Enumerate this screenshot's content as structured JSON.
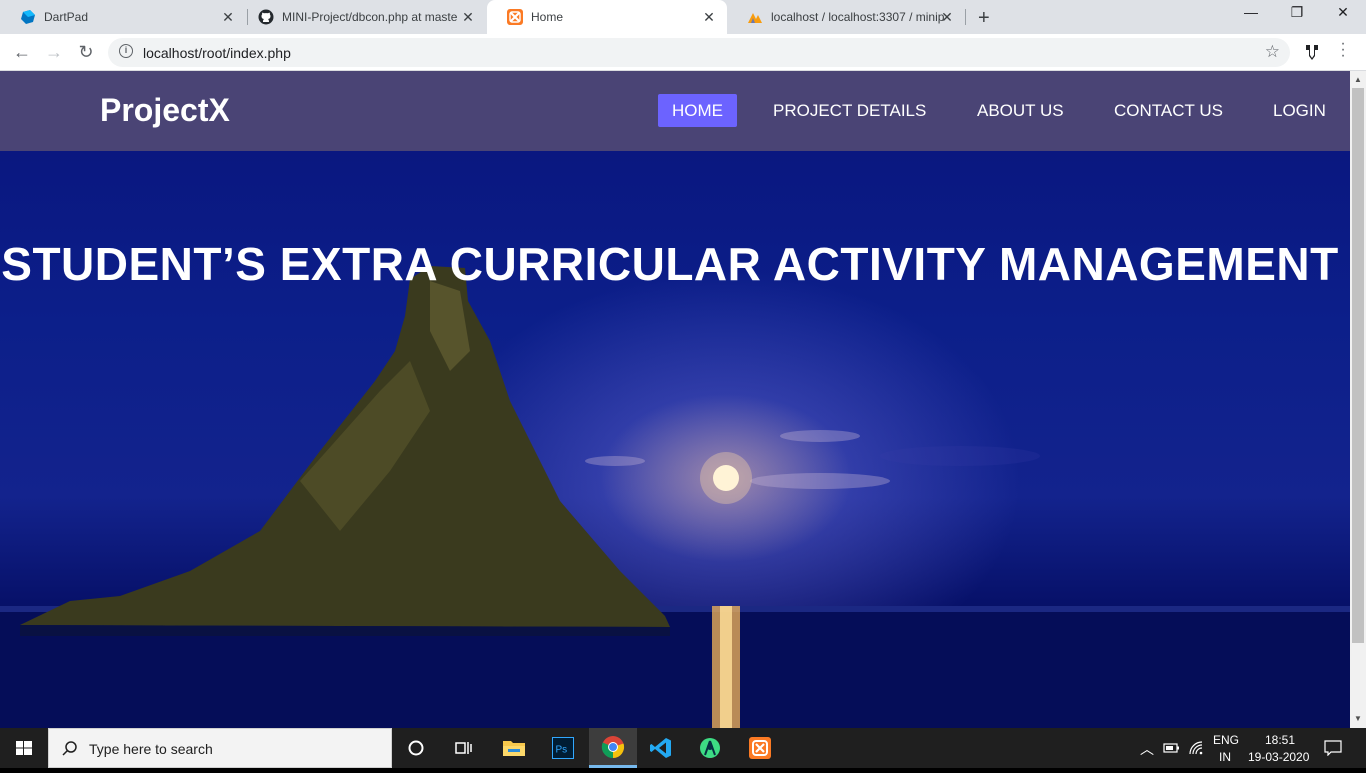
{
  "browser": {
    "tabs": [
      {
        "title": "DartPad",
        "icon": "dartpad-icon",
        "active": false
      },
      {
        "title": "MINI-Project/dbcon.php at maste",
        "icon": "github-icon",
        "active": false
      },
      {
        "title": "Home",
        "icon": "xampp-icon",
        "active": true
      },
      {
        "title": "localhost / localhost:3307 / minip",
        "icon": "phpmyadmin-icon",
        "active": false
      }
    ],
    "new_tab": "+",
    "url": "localhost/root/index.php"
  },
  "site": {
    "brand": "ProjectX",
    "nav": [
      {
        "label": "HOME",
        "active": true
      },
      {
        "label": "PROJECT DETAILS",
        "active": false
      },
      {
        "label": "ABOUT US",
        "active": false
      },
      {
        "label": "CONTACT US",
        "active": false
      },
      {
        "label": "LOGIN",
        "active": false
      }
    ],
    "hero_title": "STUDENT’S EXTRA  CURRICULAR ACTIVITY MANAGEMENT"
  },
  "taskbar": {
    "search_placeholder": "Type here to search",
    "language_top": "ENG",
    "language_bottom": "IN",
    "time": "18:51",
    "date": "19-03-2020"
  },
  "colors": {
    "nav_bg": "#4a4475",
    "nav_active": "#6c63ff",
    "hero_bg": "#0c1f8a"
  }
}
